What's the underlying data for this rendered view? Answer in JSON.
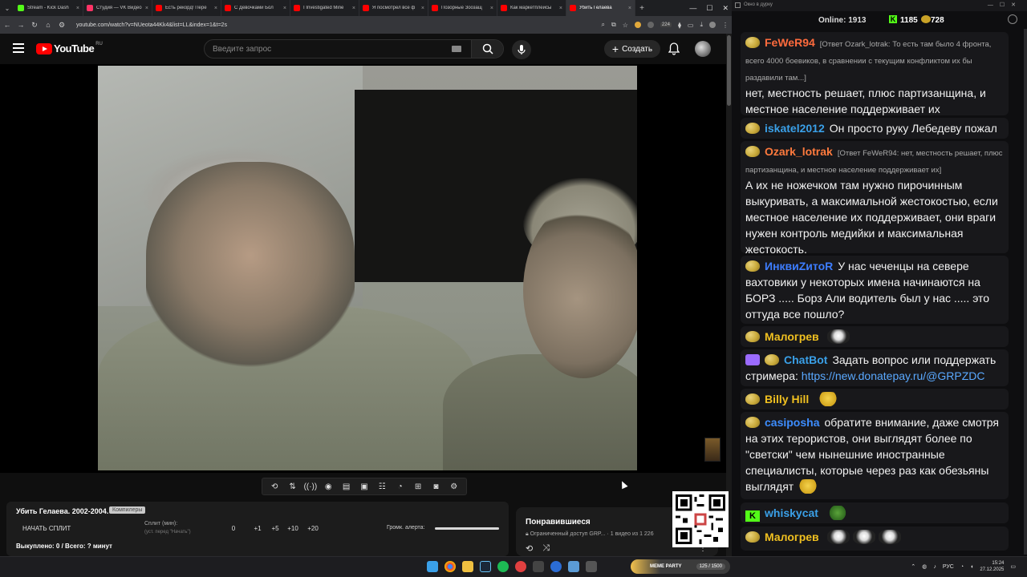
{
  "browser": {
    "tabs": [
      {
        "title": "Stream - Kick Dash",
        "color": "#53fc18",
        "active": false
      },
      {
        "title": "Студия — VK Видео",
        "color": "#ff3366",
        "active": false
      },
      {
        "title": "Есть рекорд! Пере",
        "color": "#ff0000",
        "active": false
      },
      {
        "title": "С Девочками Бол",
        "color": "#ff0000",
        "active": false
      },
      {
        "title": "I Investigated Mine",
        "color": "#ff0000",
        "active": false
      },
      {
        "title": "Я посмотрел все ф",
        "color": "#ff0000",
        "active": false
      },
      {
        "title": "Позорные Зоозащ",
        "color": "#ff0000",
        "active": false
      },
      {
        "title": "Как маркетплейсы",
        "color": "#ff0000",
        "active": false
      },
      {
        "title": "Убить Гелаева",
        "color": "#ff0000",
        "active": true
      }
    ],
    "url": "youtube.com/watch?v=NUeota44Kk4&list=LL&index=1&t=2s",
    "badge": "224"
  },
  "youtube": {
    "logo_text": "YouTube",
    "region": "RU",
    "search_placeholder": "Введите запрос",
    "create_label": "Создать"
  },
  "split_panel": {
    "title": "Убить Гелаева. 2002-2004.",
    "badge": "Компилеры",
    "start_label": "НАЧАТЬ СПЛИТ",
    "split_label": "Сплит (мин):",
    "split_hint": "(уст. перед \"Начать\")",
    "numbers": [
      "0",
      "+1",
      "+5",
      "+10",
      "+20"
    ],
    "alert_label": "Громк. алерта:",
    "alert_volume": 1.0,
    "status": "Выкуплено: 0 / Всего: ? минут"
  },
  "liked_panel": {
    "title": "Понравившиеся",
    "subtitle": "Ограниченный доступ  GRP...",
    "count": "1 видео из 1 226"
  },
  "chat": {
    "window_title": "Окно в дурку",
    "online_label": "Online:",
    "online_count": "1913",
    "kick_count": "1185",
    "pepe_count": "728",
    "messages": [
      {
        "name": "FeWeR94",
        "color": "#ff6b3d",
        "reply": "[Ответ Ozark_lotrak: То есть там было 4 фронта, всего 4000 боевиков, в сравнении с текущим конфликтом их бы раздавили там...]",
        "text": "нет, местность решает, плюс партизанщина, и местное население поддерживает их"
      },
      {
        "name": "iskatel2012",
        "color": "#3aa0e8",
        "text": "Он просто руку Лебедеву пожал"
      },
      {
        "name": "Ozark_lotrak",
        "color": "#ff7a3d",
        "reply": "[Ответ FeWeR94: нет, местность решает, плюс партизанщина, и местное население поддерживает их]",
        "text": "А их не ножечком там нужно пирочинным выкуривать, а максимальной жестокостью, если местное население их поддерживает, они враги нужен контроль медийки и максимальная жестокость."
      },
      {
        "name": "ИнквиZитоR",
        "color": "#3d7dff",
        "text": "У нас чеченцы на севере вахтовики у некоторых имена начинаются на БОРЗ ..... Борз Али водитель был у нас ..... это оттуда все пошло?"
      },
      {
        "name": "Малогрев",
        "color": "#f0c020",
        "text": ""
      },
      {
        "name": "ChatBot",
        "color": "#3aa0e8",
        "text": "Задать вопрос или поддержать стримера:",
        "link": "https://new.donatepay.ru/@GRPZDC"
      },
      {
        "name": "Billy Hill",
        "color": "#f0c020",
        "text": ""
      },
      {
        "name": "casiposha",
        "color": "#3d8dff",
        "text": "обратите внимание, даже смотря на этих терористов, они выглядят более по \"светски\" чем нынешние иностранные специалисты, которые через раз как обезьяны выглядят"
      },
      {
        "name": "whiskycat",
        "color": "#3aa0e8",
        "text": ""
      },
      {
        "name": "Малогрев",
        "color": "#f0c020",
        "text": ""
      }
    ]
  },
  "taskbar": {
    "widget_label": "MEME PARTY",
    "widget_count": "125 / 1500",
    "lang": "РУС",
    "time": "15:24",
    "date": "27.12.2025"
  }
}
